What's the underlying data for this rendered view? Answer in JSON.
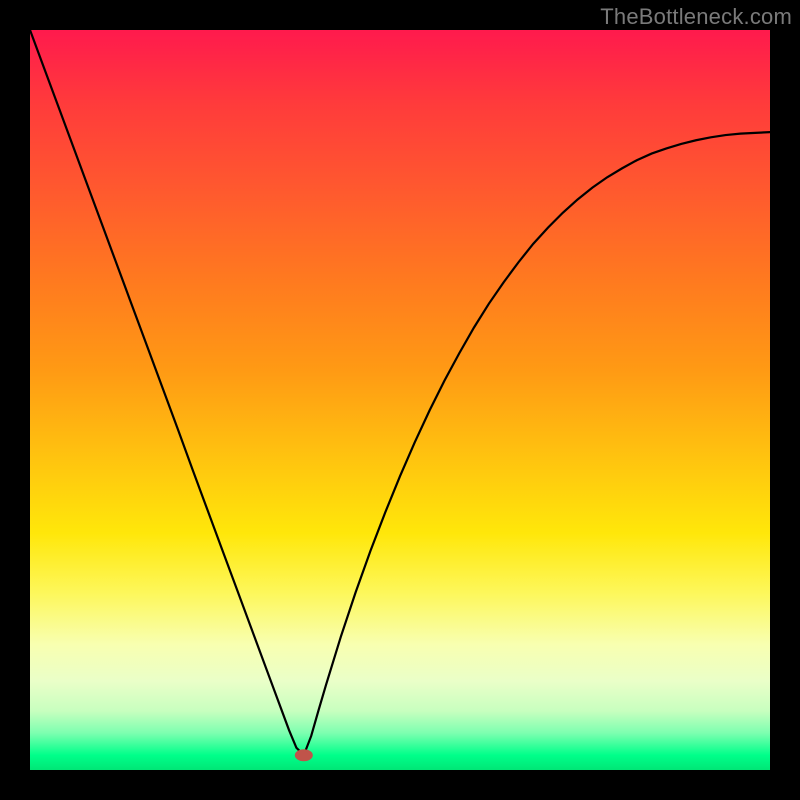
{
  "watermark": "TheBottleneck.com",
  "chart_data": {
    "type": "line",
    "title": "",
    "xlabel": "",
    "ylabel": "",
    "xlim": [
      0,
      100
    ],
    "ylim": [
      0,
      100
    ],
    "grid": false,
    "legend": false,
    "marker": {
      "x": 37,
      "y": 2,
      "color": "#c0544a"
    },
    "series": [
      {
        "name": "curve",
        "color": "#000000",
        "x": [
          0,
          2,
          4,
          6,
          8,
          10,
          12,
          14,
          16,
          18,
          20,
          22,
          24,
          26,
          28,
          30,
          32,
          33,
          34,
          35,
          36,
          37,
          38,
          39,
          40,
          42,
          44,
          46,
          48,
          50,
          52,
          54,
          56,
          58,
          60,
          62,
          64,
          66,
          68,
          70,
          72,
          74,
          76,
          78,
          80,
          82,
          84,
          86,
          88,
          90,
          92,
          94,
          96,
          98,
          100
        ],
        "y": [
          100,
          94.6,
          89.2,
          83.8,
          78.4,
          73,
          67.6,
          62.2,
          56.8,
          51.4,
          46,
          40.5,
          35.1,
          29.7,
          24.3,
          18.9,
          13.5,
          10.8,
          8.1,
          5.4,
          3,
          2,
          4.6,
          8.1,
          11.5,
          18,
          24,
          29.6,
          34.8,
          39.7,
          44.3,
          48.6,
          52.6,
          56.3,
          59.8,
          63,
          65.9,
          68.6,
          71.1,
          73.3,
          75.3,
          77.1,
          78.7,
          80.1,
          81.3,
          82.4,
          83.3,
          84,
          84.6,
          85.1,
          85.5,
          85.8,
          86,
          86.1,
          86.2
        ]
      }
    ]
  }
}
